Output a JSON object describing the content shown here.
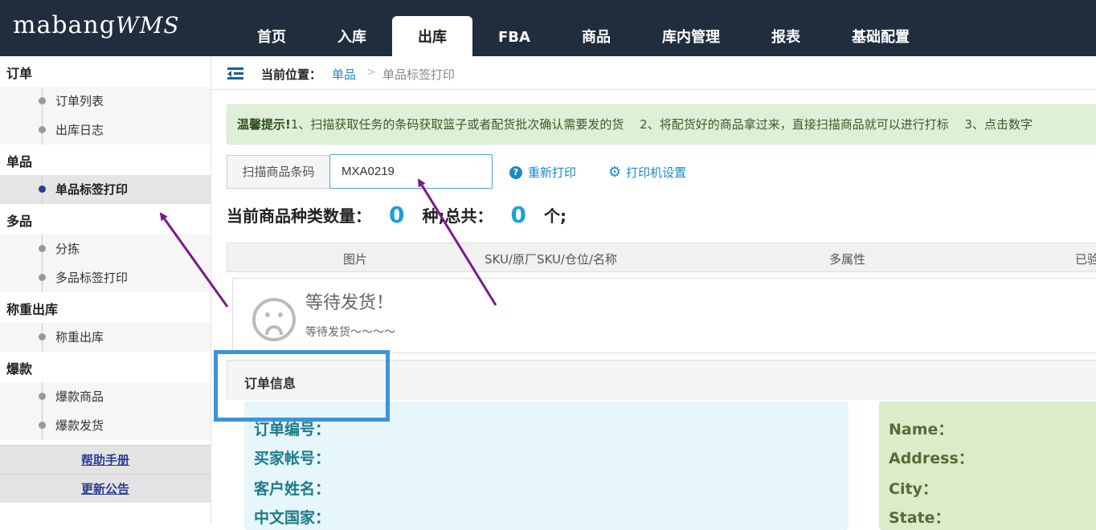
{
  "app": {
    "logo_main": "mabang",
    "logo_sub": "WMS"
  },
  "nav": [
    {
      "label": "首页"
    },
    {
      "label": "入库"
    },
    {
      "label": "出库",
      "active": true
    },
    {
      "label": "FBA"
    },
    {
      "label": "商品"
    },
    {
      "label": "库内管理"
    },
    {
      "label": "报表"
    },
    {
      "label": "基础配置"
    }
  ],
  "sidebar": {
    "sections": [
      {
        "title": "订单",
        "items": [
          "订单列表",
          "出库日志"
        ]
      },
      {
        "title": "单品",
        "items": [
          "单品标签打印"
        ]
      },
      {
        "title": "多品",
        "items": [
          "分拣",
          "多品标签打印"
        ]
      },
      {
        "title": "称重出库",
        "items": [
          "称重出库"
        ]
      },
      {
        "title": "爆款",
        "items": [
          "爆款商品",
          "爆款发货"
        ]
      }
    ],
    "active_item": "单品标签打印",
    "links": [
      "帮助手册",
      "更新公告"
    ]
  },
  "breadcrumb": {
    "label": "当前位置：",
    "link": "单品",
    "separator": ">",
    "current": "单品标签打印"
  },
  "tip": {
    "bold": "温馨提示!",
    "text": "1、扫描获取任务的条码获取篮子或者配货批次确认需要发的货　 2、将配货好的商品拿过来，直接扫描商品就可以进行打标　 3、点击数字"
  },
  "scan": {
    "label": "扫描商品条码",
    "value": "MXA0219"
  },
  "actions": {
    "reprint": "重新打印",
    "printer_settings": "打印机设置"
  },
  "counts": {
    "kinds_label": "当前商品种类数量：",
    "kinds_value": "0",
    "kinds_unit": "种;",
    "total_label": "总共：",
    "total_value": "0",
    "total_unit": "个;"
  },
  "table": {
    "headers": [
      "图片",
      "SKU/原厂SKU/仓位/名称",
      "多属性",
      "已验"
    ]
  },
  "empty": {
    "title": "等待发货！",
    "subtitle": "等待发货～～～～"
  },
  "order": {
    "header": "订单信息",
    "left_fields": [
      "订单编号：",
      "买家帐号：",
      "客户姓名：",
      "中文国家："
    ],
    "right_fields": [
      "Name：",
      "Address：",
      "City：",
      "State："
    ]
  },
  "colors": {
    "topbar": "#1f2d3d",
    "accent": "#1a88c9",
    "highlight": "#3e93da",
    "arrow": "#7a1a8a"
  }
}
